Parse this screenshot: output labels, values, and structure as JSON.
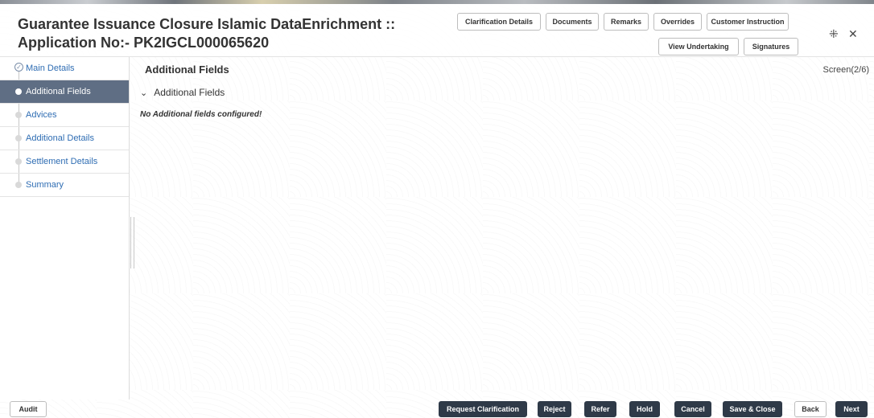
{
  "app": {
    "title": "Guarantee Issuance Closure Islamic DataEnrichment :: Application No:- PK2IGCL000065620"
  },
  "header_buttons": {
    "clarification_details": "Clarification Details",
    "documents": "Documents",
    "remarks": "Remarks",
    "overrides": "Overrides",
    "customer_instruction": "Customer Instruction",
    "view_undertaking": "View Undertaking",
    "signatures": "Signatures"
  },
  "window_controls": {
    "minimize_icon": "compress-icon",
    "close_icon": "close-icon",
    "minimize_glyph": "⁜",
    "close_glyph": "✕"
  },
  "sidebar": {
    "items": [
      {
        "label": "Main Details",
        "state": "completed"
      },
      {
        "label": "Additional Fields",
        "state": "active"
      },
      {
        "label": "Advices",
        "state": "pending"
      },
      {
        "label": "Additional Details",
        "state": "pending"
      },
      {
        "label": "Settlement Details",
        "state": "pending"
      },
      {
        "label": "Summary",
        "state": "pending"
      }
    ]
  },
  "main": {
    "section_title": "Additional Fields",
    "screen_indicator": "Screen(2/6)",
    "accordion_label": "Additional Fields",
    "empty_message": "No Additional fields configured!"
  },
  "footer": {
    "audit": "Audit",
    "request_clarification": "Request Clarification",
    "reject": "Reject",
    "refer": "Refer",
    "hold": "Hold",
    "cancel": "Cancel",
    "save_close": "Save & Close",
    "back": "Back",
    "next": "Next"
  },
  "colors": {
    "active_nav": "#5f6e84",
    "primary_button": "#2f3a48",
    "link_text": "#2f6db3"
  }
}
